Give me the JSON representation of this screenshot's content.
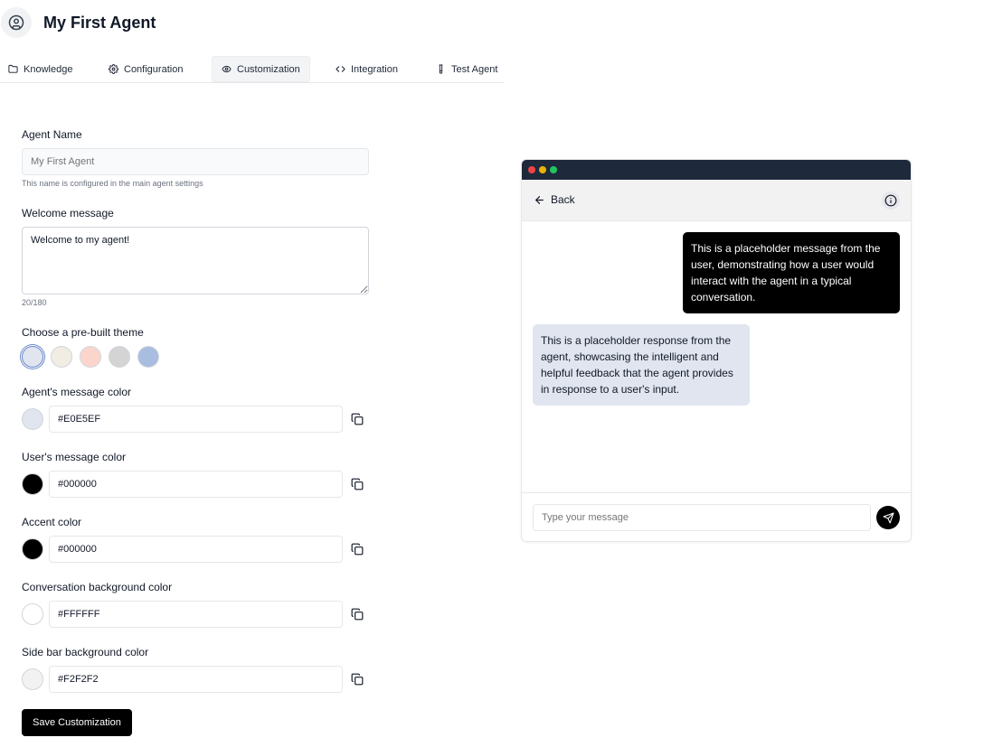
{
  "header": {
    "title": "My First Agent",
    "icon": "user-circle-icon"
  },
  "tabs": [
    {
      "label": "Knowledge",
      "icon": "folder-icon"
    },
    {
      "label": "Configuration",
      "icon": "gear-icon"
    },
    {
      "label": "Customization",
      "icon": "eye-icon",
      "active": true
    },
    {
      "label": "Integration",
      "icon": "code-icon"
    },
    {
      "label": "Test Agent",
      "icon": "test-tube-icon"
    }
  ],
  "form": {
    "agent_name": {
      "label": "Agent Name",
      "placeholder": "My First Agent",
      "hint": "This name is configured in the main agent settings"
    },
    "welcome": {
      "label": "Welcome message",
      "value": "Welcome to my agent!",
      "counter": "20/180"
    },
    "theme": {
      "label": "Choose a pre-built theme",
      "swatches": [
        "#e0e5ef",
        "#f2ede3",
        "#fbd5cc",
        "#d4d4d4",
        "#a9bde0"
      ],
      "selected": 0
    },
    "agent_color": {
      "label": "Agent's message color",
      "value": "#E0E5EF"
    },
    "user_color": {
      "label": "User's message color",
      "value": "#000000"
    },
    "accent_color": {
      "label": "Accent color",
      "value": "#000000"
    },
    "conversation_bg": {
      "label": "Conversation background color",
      "value": "#FFFFFF"
    },
    "sidebar_bg": {
      "label": "Side bar background color",
      "value": "#F2F2F2"
    },
    "save_label": "Save Customization"
  },
  "preview": {
    "back_label": "Back",
    "user_message": "This is a placeholder message from the user, demonstrating how a user would interact with the agent in a typical conversation.",
    "agent_message": "This is a placeholder response from the agent, showcasing the intelligent and helpful feedback that the agent provides in response to a user's input.",
    "composer_placeholder": "Type your message",
    "traffic_lights": [
      "#ef4444",
      "#eab308",
      "#22c55e"
    ]
  }
}
